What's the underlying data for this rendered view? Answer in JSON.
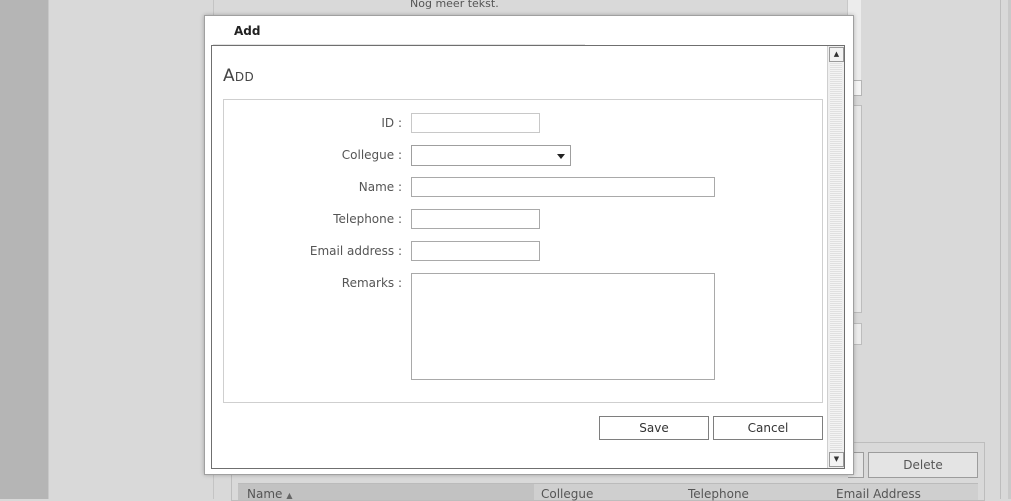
{
  "background": {
    "top_text": "Nog meer tekst.",
    "delete_label": "Delete",
    "grid_columns": [
      "Name",
      "Collegue",
      "Telephone",
      "Email Address"
    ]
  },
  "dialog": {
    "title": "Add",
    "heading": "Add",
    "fields": {
      "id": {
        "label": "ID :",
        "value": ""
      },
      "collegue": {
        "label": "Collegue :",
        "selected": ""
      },
      "name": {
        "label": "Name :",
        "value": ""
      },
      "telephone": {
        "label": "Telephone :",
        "value": ""
      },
      "email": {
        "label": "Email address :",
        "value": ""
      },
      "remarks": {
        "label": "Remarks :",
        "value": ""
      }
    },
    "buttons": {
      "save": "Save",
      "cancel": "Cancel"
    }
  },
  "icons": {
    "sort": "sort-ascending-icon",
    "dropdown": "dropdown-arrow-icon",
    "scroll_up": "scroll-up-icon",
    "scroll_down": "scroll-down-icon"
  }
}
